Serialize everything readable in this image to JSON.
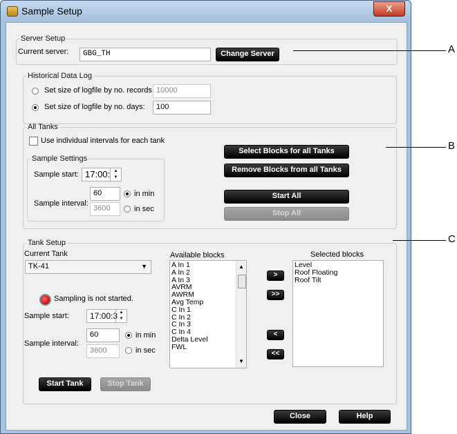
{
  "window": {
    "title": "Sample Setup",
    "close_glyph": "X"
  },
  "server_setup": {
    "legend": "Server Setup",
    "current_server_label": "Current server:",
    "current_server_value": "GBG_TH",
    "change_server_button": "Change Server"
  },
  "historical_log": {
    "legend": "Historical Data Log",
    "option_records_label": "Set size of logfile by no. records",
    "option_records_value": "10000",
    "option_days_label": "Set size of logfile by no. days:",
    "option_days_value": "100",
    "selected": "days"
  },
  "all_tanks": {
    "legend": "All Tanks",
    "individual_intervals_label": "Use individual intervals for each tank",
    "individual_intervals_checked": false,
    "sample_settings": {
      "legend": "Sample Settings",
      "start_label": "Sample start:",
      "start_value": "17:00:",
      "interval_label": "Sample interval:",
      "min_value": "60",
      "min_label": "in min",
      "sec_value": "3600",
      "sec_label": "in sec",
      "selected_unit": "min"
    },
    "select_blocks_button": "Select Blocks for all Tanks",
    "remove_blocks_button": "Remove Blocks from all Tanks",
    "start_all_button": "Start All",
    "stop_all_button": "Stop All"
  },
  "tank_setup": {
    "legend": "Tank Setup",
    "current_tank_label": "Current Tank",
    "current_tank_value": "TK-41",
    "status_text": "Sampling is not started.",
    "start_label": "Sample start:",
    "start_value": "17:00:3",
    "interval_label": "Sample interval:",
    "min_value": "60",
    "min_label": "in min",
    "sec_value": "3600",
    "sec_label": "in sec",
    "selected_unit": "min",
    "available_label": "Available blocks",
    "available_blocks": [
      "A In 1",
      "A In 2",
      "A In 3",
      "AVRM",
      "AWRM",
      "Avg Temp",
      "C In 1",
      "C In 2",
      "C In 3",
      "C In 4",
      "Delta Level",
      "FWL"
    ],
    "selected_label": "Selected blocks",
    "selected_blocks": [
      "Level",
      "Roof Floating",
      "Roof Tilt"
    ],
    "move_one_right": ">",
    "move_all_right": ">>",
    "move_one_left": "<",
    "move_all_left": "<<",
    "start_tank_button": "Start Tank",
    "stop_tank_button": "Stop Tank"
  },
  "footer": {
    "close_button": "Close",
    "help_button": "Help"
  },
  "callouts": {
    "a": "A",
    "b": "B",
    "c": "C"
  },
  "colors": {
    "status_red": "#d01818",
    "button_black": "#000000"
  },
  "icons": [
    "app-icon",
    "close-icon",
    "dropdown-arrow-icon",
    "spin-up-icon",
    "spin-down-icon",
    "status-led-icon",
    "scroll-up-icon",
    "scroll-down-icon"
  ]
}
